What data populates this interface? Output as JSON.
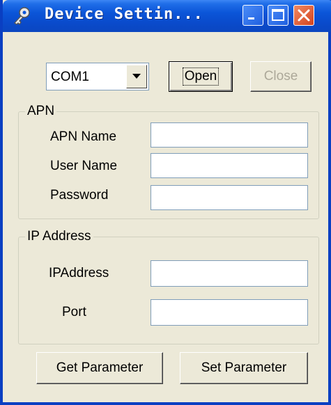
{
  "window": {
    "title": "Device Settin...",
    "controls": {
      "minimize": "minimize",
      "maximize": "maximize",
      "close": "close"
    }
  },
  "port": {
    "selected": "COM1",
    "open_label": "Open",
    "close_label": "Close"
  },
  "apn_group": {
    "title": "APN",
    "apn_name_label": "APN Name",
    "apn_name_value": "",
    "user_name_label": "User Name",
    "user_name_value": "",
    "password_label": "Password",
    "password_value": ""
  },
  "ip_group": {
    "title": "IP Address",
    "ip_label": "IPAddress",
    "ip_value": "",
    "port_label": "Port",
    "port_value": ""
  },
  "actions": {
    "get_label": "Get Parameter",
    "set_label": "Set Parameter"
  },
  "icons": {
    "title": "key-wrench-icon",
    "combo_arrow": "triangle-down-icon"
  },
  "colors": {
    "titlebar": "#0b55d8",
    "window_bg": "#ece9d8",
    "close_button": "#d4431e"
  }
}
